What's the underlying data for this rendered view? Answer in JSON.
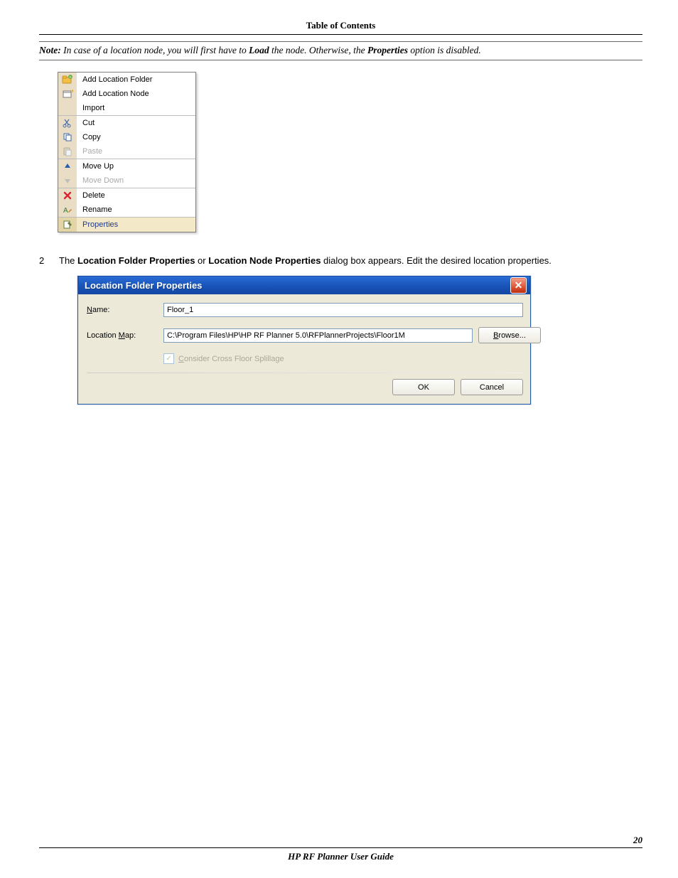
{
  "header": {
    "toc": "Table of Contents"
  },
  "note": {
    "label": "Note:",
    "text1": " In case of a location node, you will first have to ",
    "load": "Load",
    "text2": " the node. Otherwise, the ",
    "properties": "Properties",
    "text3": " option is disabled."
  },
  "context_menu": {
    "groups": [
      {
        "items": [
          {
            "icon": "folder-add-icon",
            "label": "Add Location Folder",
            "disabled": false
          },
          {
            "icon": "node-add-icon",
            "label": "Add Location Node",
            "disabled": false
          },
          {
            "icon": "blank-icon",
            "label": "Import",
            "disabled": false
          }
        ]
      },
      {
        "items": [
          {
            "icon": "cut-icon",
            "label": "Cut",
            "disabled": false
          },
          {
            "icon": "copy-icon",
            "label": "Copy",
            "disabled": false
          },
          {
            "icon": "paste-icon",
            "label": "Paste",
            "disabled": true
          }
        ]
      },
      {
        "items": [
          {
            "icon": "move-up-icon",
            "label": "Move Up",
            "disabled": false
          },
          {
            "icon": "move-down-icon",
            "label": "Move Down",
            "disabled": true
          }
        ]
      },
      {
        "items": [
          {
            "icon": "delete-icon",
            "label": "Delete",
            "disabled": false
          },
          {
            "icon": "rename-icon",
            "label": "Rename",
            "disabled": false
          }
        ]
      },
      {
        "items": [
          {
            "icon": "properties-icon",
            "label": "Properties",
            "disabled": false,
            "highlight": true
          }
        ]
      }
    ]
  },
  "step": {
    "num": "2",
    "pre": "The ",
    "b1": "Location Folder Properties",
    "mid1": " or ",
    "b2": "Location Node Properties",
    "post": " dialog box appears. Edit the desired location properties."
  },
  "dialog": {
    "title": "Location Folder Properties",
    "close_symbol": "✕",
    "name_label_u": "N",
    "name_label_rest": "ame:",
    "name_value": "Floor_1",
    "map_label_pre": "Location ",
    "map_label_u": "M",
    "map_label_post": "ap:",
    "map_value": "C:\\Program Files\\HP\\HP RF Planner 5.0\\RFPlannerProjects\\Floor1M",
    "browse_u": "B",
    "browse_rest": "rowse...",
    "chk_pre": "C",
    "chk_label": "onsider Cross Floor Splillage",
    "ok": "OK",
    "cancel": "Cancel"
  },
  "footer": {
    "page": "20",
    "title": "HP RF Planner User Guide"
  }
}
